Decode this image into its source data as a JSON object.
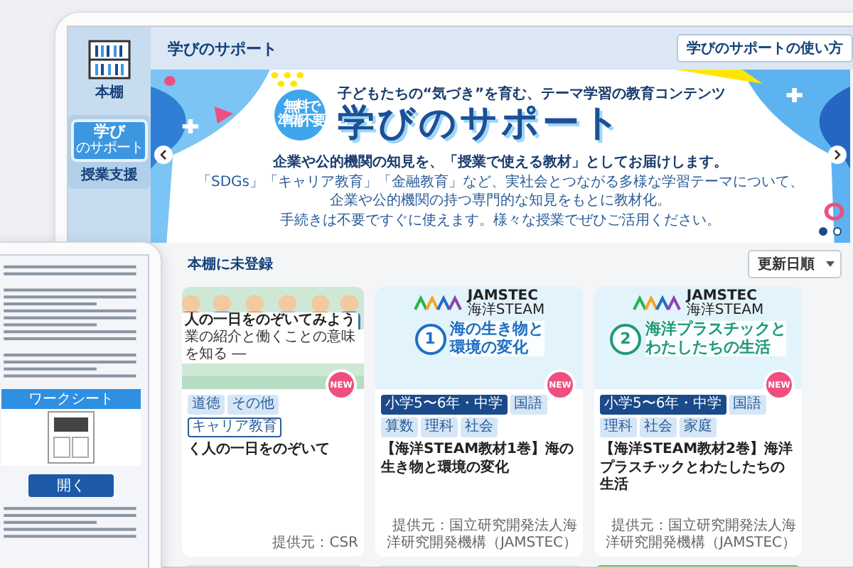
{
  "header": {
    "title": "学びのサポート",
    "help_button": "学びのサポートの使い方"
  },
  "sidebar": {
    "items": [
      {
        "kind": "shelf",
        "label": "本棚",
        "selected": false
      },
      {
        "kind": "support",
        "icon_title": "学び",
        "icon_sub": "のサポート",
        "label": "授業支援",
        "selected": true
      }
    ]
  },
  "banner": {
    "badge": [
      "無料で",
      "準備不要"
    ],
    "tagline": "子どもたちの“気づき”を育む、テーマ学習の教育コンテンツ",
    "title": "学びのサポート",
    "lead": "企業や公的機関の知見を、「授業で使える教材」としてお届けします。",
    "body": [
      "「SDGs」「キャリア教育」「金融教育」など、実社会とつながる多様な学習テーマについて、",
      "企業や公的機関の持つ専門的な知見をもとに教材化。",
      "手続きは不要ですぐに使えます。様々な授業でぜひご活用ください。"
    ],
    "slides": [
      {
        "selected": true
      },
      {
        "selected": false
      }
    ]
  },
  "list": {
    "heading": "本棚に未登録",
    "sort": "更新日順"
  },
  "cards": [
    {
      "thumb": {
        "kind": "people",
        "caption": "人の一日をのぞいてみよう",
        "subcaption": "業の紹介と働くことの意味を知る ―"
      },
      "badge": "NEW",
      "tags": [
        {
          "kind": "subject",
          "label": "道徳"
        },
        {
          "kind": "subject",
          "label": "その他"
        },
        {
          "kind": "theme",
          "label": "キャリア教育"
        }
      ],
      "title": "く人の一日をのぞいて",
      "provider": "提供元：CSR"
    },
    {
      "thumb": {
        "kind": "ocean",
        "color": "#1f6fc4",
        "logo": "JAMSTEC",
        "series": "海洋STEAM",
        "volume": "1",
        "heading": [
          "海の生き物と",
          "環境の変化"
        ]
      },
      "badge": "NEW",
      "tags": [
        {
          "kind": "grade",
          "label": "小学5〜6年・中学"
        },
        {
          "kind": "subject",
          "label": "国語"
        },
        {
          "kind": "subject",
          "label": "算数"
        },
        {
          "kind": "subject",
          "label": "理科"
        },
        {
          "kind": "subject",
          "label": "社会"
        }
      ],
      "title": "【海洋STEAM教材1巻】海の生き物と環境の変化",
      "provider": "提供元：国立研究開発法人海洋研究開発機構（JAMSTEC）"
    },
    {
      "thumb": {
        "kind": "ocean",
        "color": "#1f9a78",
        "logo": "JAMSTEC",
        "series": "海洋STEAM",
        "volume": "2",
        "heading": [
          "海洋プラスチックと",
          "わたしたちの生活"
        ]
      },
      "badge": "NEW",
      "tags": [
        {
          "kind": "grade",
          "label": "小学5〜6年・中学"
        },
        {
          "kind": "subject",
          "label": "国語"
        },
        {
          "kind": "subject",
          "label": "理科"
        },
        {
          "kind": "subject",
          "label": "社会"
        },
        {
          "kind": "subject",
          "label": "家庭"
        }
      ],
      "title": "【海洋STEAM教材2巻】海洋プラスチックとわたしたちの生活",
      "provider": "提供元：国立研究開発法人海洋研究開発機構（JAMSTEC）"
    }
  ],
  "overlay_tablet": {
    "tab": "ワークシート",
    "open_button": "開く"
  }
}
